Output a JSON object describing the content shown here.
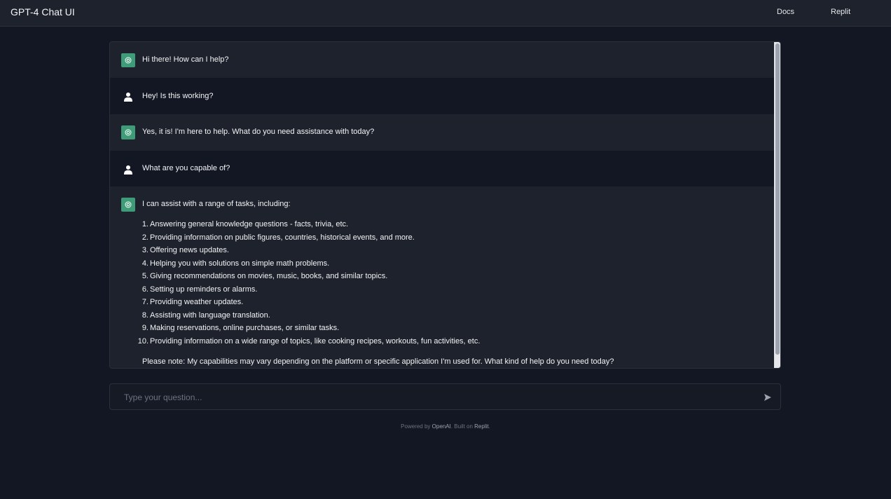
{
  "header": {
    "title": "GPT-4 Chat UI",
    "nav": [
      "Docs",
      "Replit"
    ]
  },
  "messages": [
    {
      "role": "bot",
      "text": "Hi there! How can I help?"
    },
    {
      "role": "user",
      "text": "Hey! Is this working?"
    },
    {
      "role": "bot",
      "text": "Yes, it is! I'm here to help. What do you need assistance with today?"
    },
    {
      "role": "user",
      "text": "What are you capable of?"
    },
    {
      "role": "bot",
      "text": "I can assist with a range of tasks, including:",
      "list": [
        "Answering general knowledge questions - facts, trivia, etc.",
        "Providing information on public figures, countries, historical events, and more.",
        "Offering news updates.",
        "Helping you with solutions on simple math problems.",
        "Giving recommendations on movies, music, books, and similar topics.",
        "Setting up reminders or alarms.",
        "Providing weather updates.",
        "Assisting with language translation.",
        "Making reservations, online purchases, or similar tasks.",
        "Providing information on a wide range of topics, like cooking recipes, workouts, fun activities, etc."
      ],
      "note": "Please note: My capabilities may vary depending on the platform or specific application I'm used for. What kind of help do you need today?"
    }
  ],
  "input": {
    "placeholder": "Type your question..."
  },
  "footer": {
    "prefix": "Powered by ",
    "link1": "OpenAI",
    "middle": ". Built on ",
    "link2": "Replit",
    "suffix": "."
  },
  "colors": {
    "background": "#121723",
    "panel": "#1e222c",
    "bot_avatar": "#3e9c78"
  },
  "icons": {
    "bot": "openai-logo-icon",
    "user": "user-icon",
    "send": "send-icon"
  }
}
